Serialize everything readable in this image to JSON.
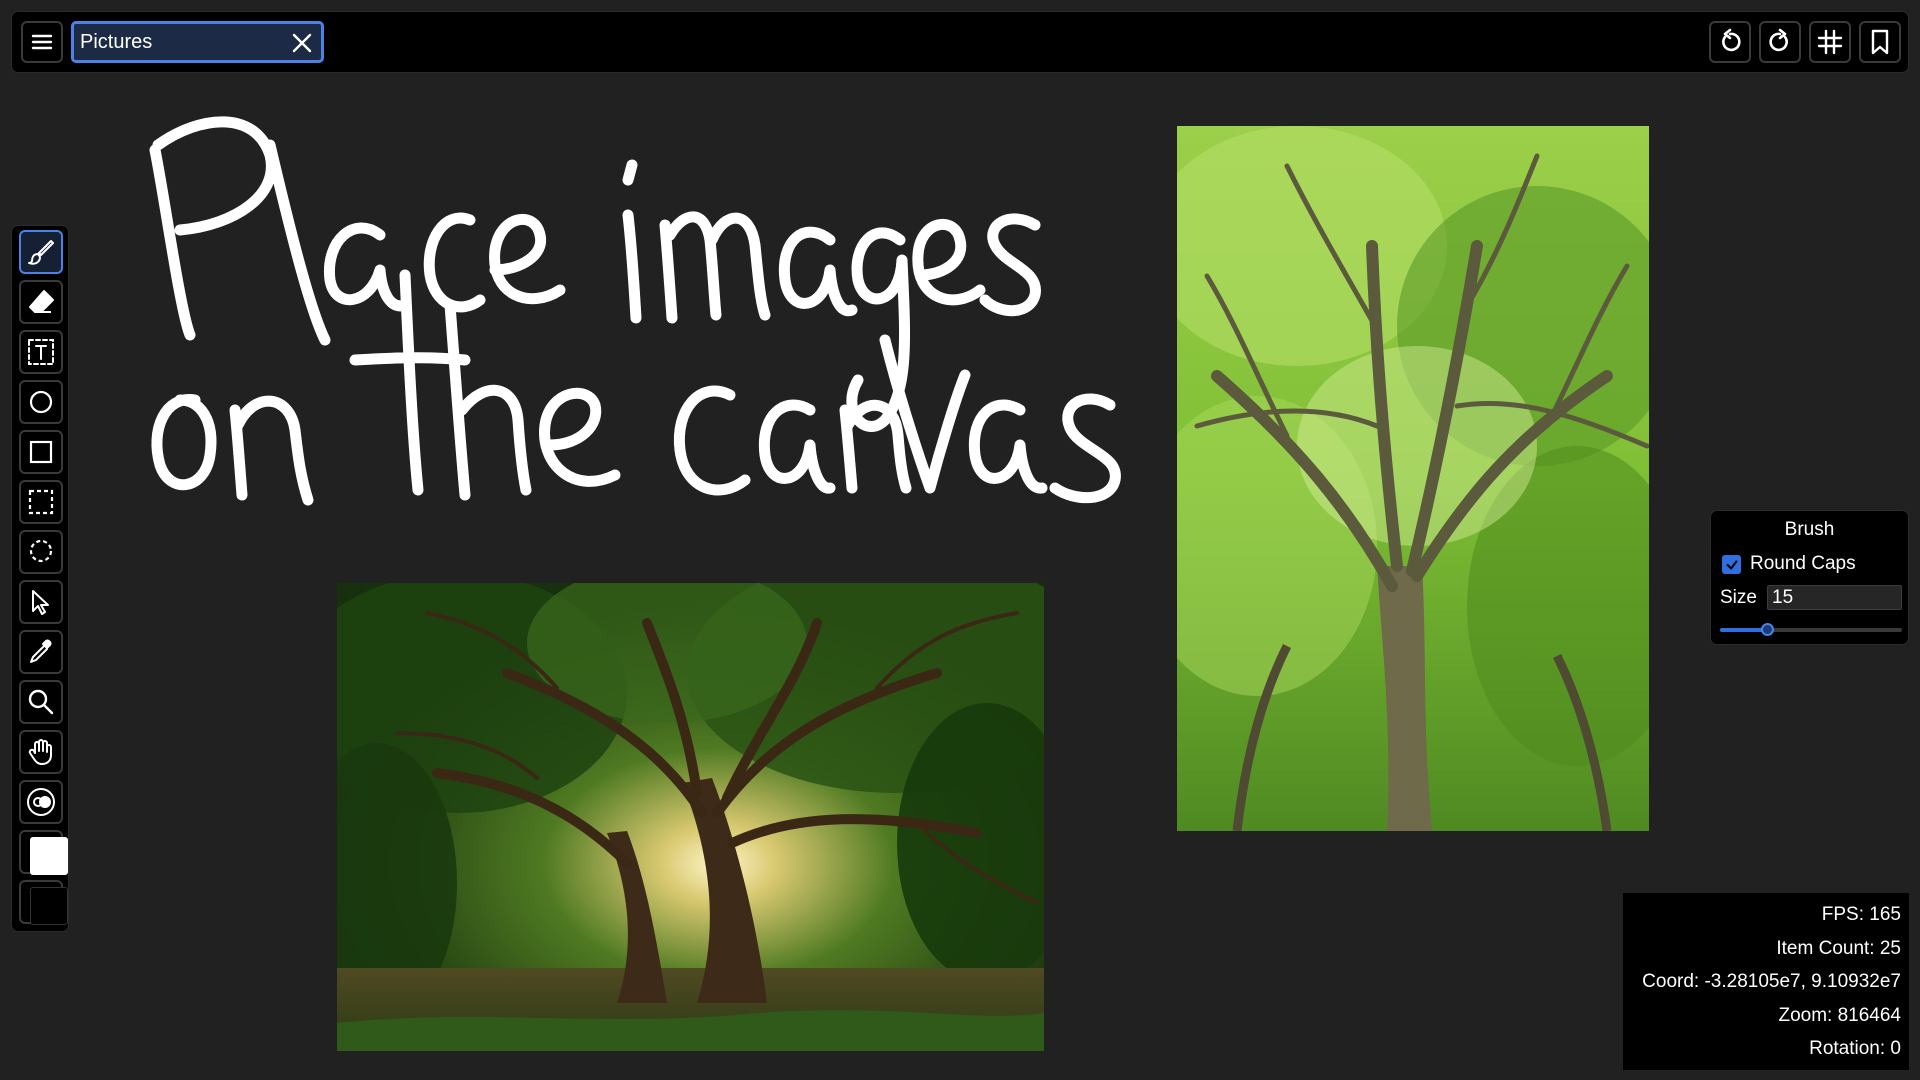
{
  "header": {
    "menu_icon": "hamburger-menu-icon",
    "name_field": {
      "value": "Pictures",
      "clear_icon": "close-icon"
    },
    "actions": [
      {
        "name": "undo",
        "icon": "undo-icon"
      },
      {
        "name": "redo",
        "icon": "redo-icon"
      },
      {
        "name": "grid",
        "icon": "grid-hash-icon"
      },
      {
        "name": "bookmark",
        "icon": "bookmark-icon"
      }
    ]
  },
  "toolbar": {
    "active_tool": "brush",
    "tools": [
      {
        "name": "brush",
        "icon": "brush-icon"
      },
      {
        "name": "eraser",
        "icon": "eraser-icon"
      },
      {
        "name": "text",
        "icon": "text-icon"
      },
      {
        "name": "ellipse",
        "icon": "circle-icon"
      },
      {
        "name": "rectangle",
        "icon": "square-icon"
      },
      {
        "name": "rect-select",
        "icon": "rect-select-icon"
      },
      {
        "name": "lasso-select",
        "icon": "lasso-select-icon"
      },
      {
        "name": "pointer",
        "icon": "pointer-icon"
      },
      {
        "name": "eyedropper",
        "icon": "eyedropper-icon"
      },
      {
        "name": "zoom",
        "icon": "magnifier-icon"
      },
      {
        "name": "pan",
        "icon": "hand-icon"
      },
      {
        "name": "toggle",
        "icon": "toggle-icon"
      }
    ],
    "foreground_color": "#ffffff",
    "background_color": "#000000"
  },
  "canvas": {
    "background_color": "#212121",
    "handwriting_text": "Place images on the canvas",
    "ink_color": "#ffffff",
    "images": [
      {
        "name": "tree-photo-wide",
        "subject": "large old tree with sunlight"
      },
      {
        "name": "tree-photo-tall",
        "subject": "green tree canopy from below"
      }
    ]
  },
  "brush_panel": {
    "title": "Brush",
    "round_caps": {
      "label": "Round Caps",
      "checked": true
    },
    "size": {
      "label": "Size",
      "value": "15",
      "slider_fraction": 0.26
    }
  },
  "stats": {
    "fps": "FPS: 165",
    "item_count": "Item Count: 25",
    "coord": "Coord: -3.28105e7, 9.10932e7",
    "zoom": "Zoom: 816464",
    "rotation": "Rotation: 0"
  },
  "colors": {
    "accent": "#4a82e6",
    "panel_bg": "#000000",
    "button_border": "#3a3a3a"
  }
}
